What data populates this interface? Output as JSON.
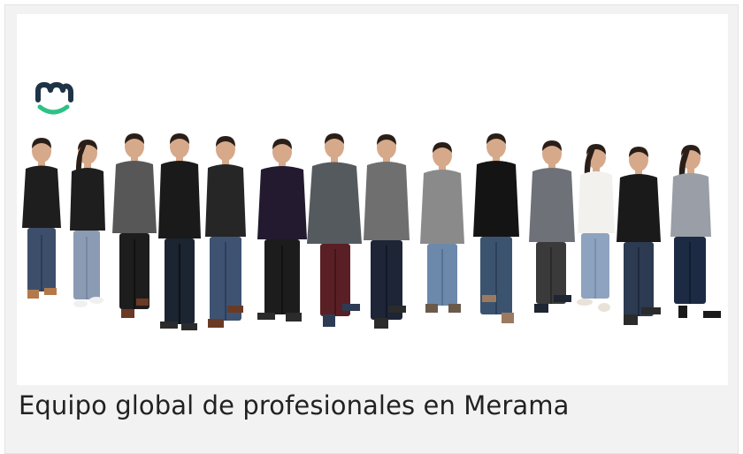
{
  "image": {
    "caption": "Equipo global de profesionales en Merama",
    "logo_icon": "merama-logo-icon",
    "colors": {
      "logo_dark": "#1f3346",
      "logo_green": "#2ec185",
      "card_bg": "#f2f2f2",
      "caption_text": "#222222"
    }
  }
}
